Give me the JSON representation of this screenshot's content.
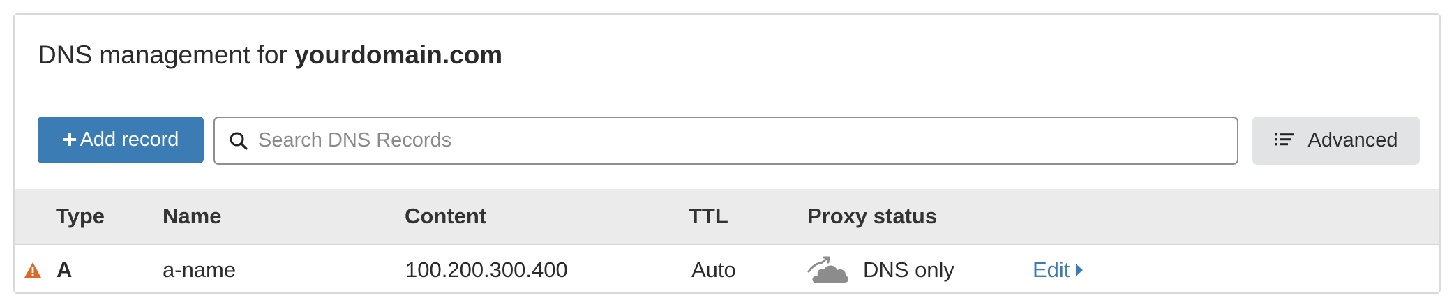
{
  "header": {
    "title_prefix": "DNS management for",
    "domain": "yourdomain.com"
  },
  "toolbar": {
    "add_label": "Add record",
    "add_icon": "plus-icon",
    "search_placeholder": "Search DNS Records",
    "search_value": "",
    "advanced_label": "Advanced",
    "advanced_icon": "list-icon",
    "accent_color": "#3c7cb5"
  },
  "table": {
    "columns": [
      "Type",
      "Name",
      "Content",
      "TTL",
      "Proxy status"
    ],
    "rows": [
      {
        "warning_icon": "warning-triangle-icon",
        "type": "A",
        "name": "a-name",
        "content": "100.200.300.400",
        "ttl": "Auto",
        "proxy_icon": "dns-only-cloud-icon",
        "proxy_status": "DNS only",
        "edit_label": "Edit"
      }
    ]
  },
  "colors": {
    "warning": "#d96a2a",
    "cloud_gray": "#8c8c8c",
    "header_bg": "#ebebeb"
  }
}
